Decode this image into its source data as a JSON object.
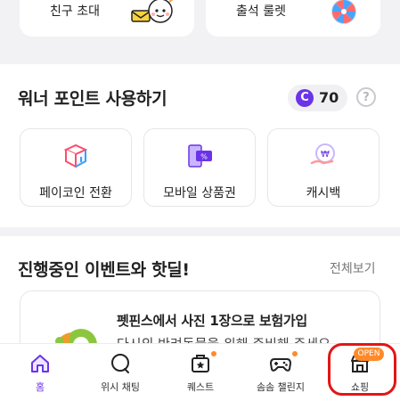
{
  "top_cards": {
    "invite_label": "친구 초대",
    "roulette_label": "출석 룰렛"
  },
  "points_section": {
    "title": "워너 포인트 사용하기",
    "coin_symbol": "C",
    "points_value": "70",
    "help_symbol": "?",
    "tiles": [
      {
        "label": "페이코인 전환",
        "icon": "paycoin-icon"
      },
      {
        "label": "모바일 상품권",
        "icon": "mobile-voucher-icon"
      },
      {
        "label": "캐시백",
        "icon": "cashback-icon"
      }
    ]
  },
  "events_section": {
    "title": "진행중인 이벤트와 핫딜!",
    "see_all": "전체보기",
    "event_title": "펫핀스에서 사진 1장으로 보험가입",
    "event_subtitle": "다시의 반려동물을 위해 준비해 주세요"
  },
  "bottom_nav": {
    "items": [
      {
        "label": "홈",
        "icon": "home-icon",
        "active": true
      },
      {
        "label": "위시 채팅",
        "icon": "chat-bubble-icon",
        "active": false
      },
      {
        "label": "퀘스트",
        "icon": "quest-star-icon",
        "active": false
      },
      {
        "label": "솜솜 챌린지",
        "icon": "gamepad-icon",
        "active": false
      },
      {
        "label": "쇼핑",
        "icon": "shop-icon",
        "active": false
      }
    ],
    "open_badge": "OPEN"
  },
  "colors": {
    "accent": "#6b34e8",
    "badge_orange": "#ff8a2a",
    "highlight_red": "#e21616"
  }
}
